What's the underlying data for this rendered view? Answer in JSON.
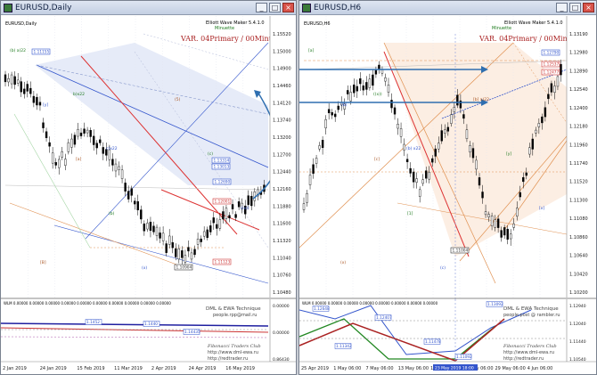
{
  "windows": [
    {
      "title": "EURUSD,Daily",
      "indicator_name": "Elliott Wave Maker 5.4.1.0",
      "indicator_sub": "Minuette",
      "var_label": "VAR. 04Primary / 00Minute",
      "legend_text": "EURUSD,Daily",
      "price_ticks": [
        "1.15520",
        "1.15000",
        "1.14900",
        "1.14460",
        "1.14120",
        "1.13740",
        "1.13200",
        "1.12700",
        "1.12440",
        "1.12160",
        "1.11880",
        "1.11600",
        "1.11320",
        "1.11040",
        "1.10760",
        "1.10480"
      ],
      "price_boxes": [
        {
          "text": "1.13314",
          "color": "#3355cc"
        },
        {
          "text": "1.13013",
          "color": "#3355cc"
        },
        {
          "text": "1.12690",
          "color": "#3355cc"
        },
        {
          "text": "1.12001",
          "color": "#cc3333"
        },
        {
          "text": "1.11123",
          "color": "#cc3333"
        },
        {
          "text": "1.11155",
          "color": "#3355cc"
        },
        {
          "text": "1.10904",
          "color": "#333333"
        }
      ],
      "wave_labels": [
        "(b) a)22",
        "[y]",
        "[a]",
        "(b)",
        "(x)",
        "(5)",
        "(c)",
        "((x))",
        "[B]",
        "b)x22",
        "c)x22"
      ],
      "ind_title": "WLM 0.00000 0.00000 0.00000 0.00000 0.00000 0.00000 0.00000 0.00000 0.00000 0.00000",
      "ind_values": [
        "1.1452",
        "1.1440",
        "1.14435"
      ],
      "ind_ticks": [
        "0.00000",
        "0.00000",
        "0.86430"
      ],
      "watermark1": "DML & EWA Technique",
      "watermark2": "people.rpp@mail.ru",
      "watermark3": "Fibonacci Traders Club",
      "watermark4": "http://www.dml-ewa.ru",
      "watermark5": "http://redtrader.ru",
      "x_labels": [
        "2 Jan 2019",
        "24 Jan 2019",
        "15 Feb 2019",
        "11 Mar 2019",
        "2 Apr 2019",
        "24 Apr 2019",
        "16 May 2019"
      ]
    },
    {
      "title": "EURUSD,H6",
      "indicator_name": "Elliott Wave Maker 5.4.1.0",
      "indicator_sub": "Minuette",
      "var_label": "VAR. 04Primary / 00Minute",
      "legend_text": "EURUSD,H6",
      "price_ticks": [
        "1.13190",
        "1.12980",
        "1.12890",
        "1.12540",
        "1.12400",
        "1.12180",
        "1.11960",
        "1.11740",
        "1.11520",
        "1.11300",
        "1.11080",
        "1.10860",
        "1.10640",
        "1.10420",
        "1.10200"
      ],
      "price_boxes": [
        {
          "text": "1.12790",
          "color": "#3355cc"
        },
        {
          "text": "1.12537",
          "color": "#cc3333"
        },
        {
          "text": "1.12477",
          "color": "#cc3333"
        },
        {
          "text": "1.11004",
          "color": "#333333"
        }
      ],
      "wave_labels": [
        "[a]",
        "(b)",
        "[c]",
        "[1]",
        "(c)",
        "[b] a)22",
        "[y]",
        "[x]",
        "(x)",
        "((x))",
        "(b) x22"
      ],
      "ind_title": "WLM 0.00000 0.00000 0.00000 0.00000 0.00000 0.00000 0.00000 0.00000",
      "ind_values": [
        "1.12648",
        "1.12407",
        "1.11342",
        "1.11478",
        "1.13092",
        "1.11092"
      ],
      "ind_ticks": [
        "1.12940",
        "1.12040",
        "1.11440",
        "1.10540"
      ],
      "watermark1": "DML & EWA Technique",
      "watermark2": "people.post @ rambler.ru",
      "watermark3": "Fibonacci Traders Club",
      "watermark4": "http://www.dml-ewa.ru",
      "watermark5": "http://redtrader.ru",
      "x_labels": [
        "25 Apr 2019",
        "1 May 06:00",
        "7 May 06:00",
        "13 May 06:00",
        "17 May",
        "23 May 06:00",
        "29 May 06:00",
        "4 Jun 06:00"
      ],
      "cursor_label": "23 May 2019 18:00"
    }
  ],
  "colors": {
    "bull": "#ffffff",
    "bear": "#000000",
    "var_text": "#aa2222",
    "blue_line": "#3355cc",
    "red_line": "#dd3333",
    "orange_line": "#e09050",
    "green_line": "#228822",
    "arrow": "#2f6fb0"
  }
}
